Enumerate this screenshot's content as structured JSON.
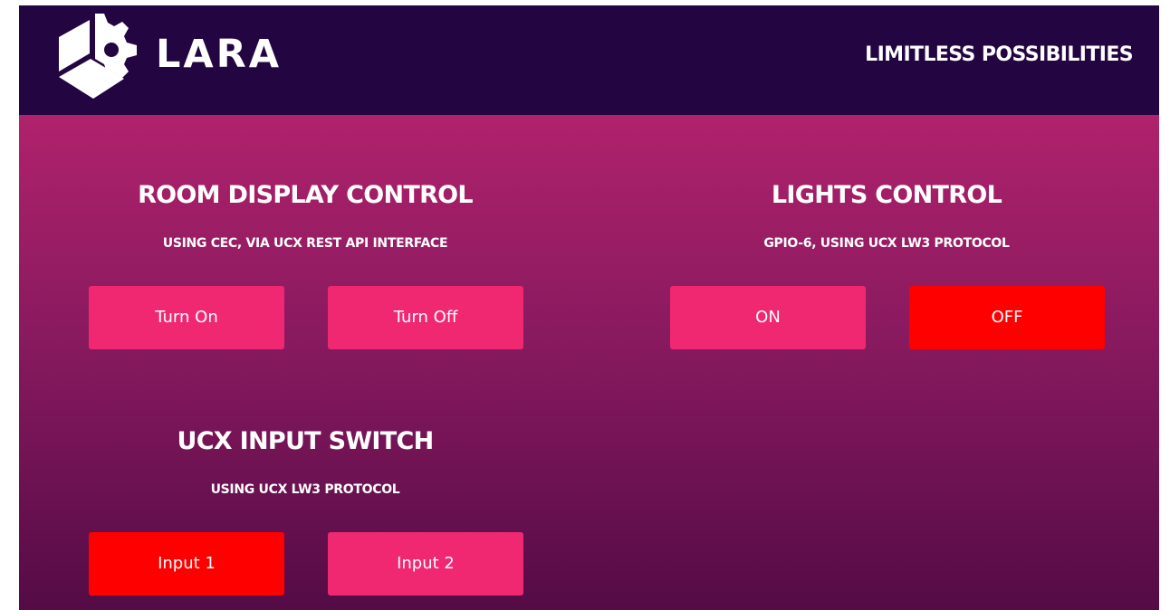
{
  "header": {
    "brand": "LARA",
    "tagline": "LIMITLESS POSSIBILITIES"
  },
  "colors": {
    "header_bg": "#230541",
    "panel_top": "#b0226c",
    "panel_bottom": "#540b46",
    "button": "#f02872",
    "button_active": "#ff0000"
  },
  "sections": {
    "room_display": {
      "title": "ROOM DISPLAY CONTROL",
      "subtitle": "USING CEC, VIA UCX REST API INTERFACE",
      "buttons": [
        {
          "label": "Turn On",
          "active": false
        },
        {
          "label": "Turn Off",
          "active": false
        }
      ]
    },
    "lights": {
      "title": "LIGHTS CONTROL",
      "subtitle": "GPIO-6, USING UCX LW3 PROTOCOL",
      "buttons": [
        {
          "label": "ON",
          "active": false
        },
        {
          "label": "OFF",
          "active": true
        }
      ]
    },
    "input_switch": {
      "title": "UCX INPUT SWITCH",
      "subtitle": "USING UCX LW3 PROTOCOL",
      "buttons": [
        {
          "label": "Input 1",
          "active": true
        },
        {
          "label": "Input 2",
          "active": false
        }
      ]
    }
  }
}
